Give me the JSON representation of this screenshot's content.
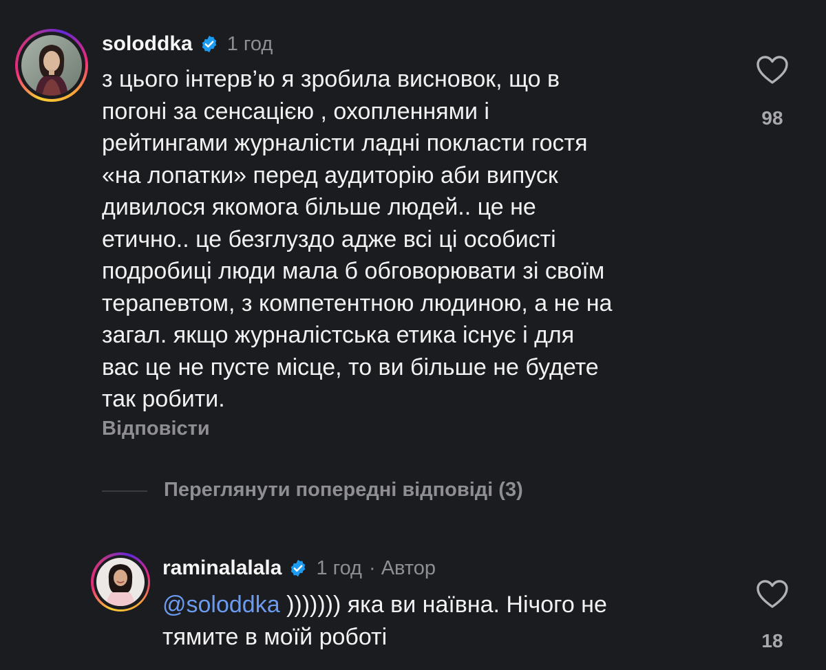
{
  "comments": [
    {
      "username": "soloddka",
      "time": "1 год",
      "body_lines": [
        "з цього інтерв’ю я зробила висновок, що в",
        "погоні за сенсацією , охопленнями і",
        "рейтингами журналісти ладні покласти гостя",
        "«на лопатки» перед аудиторію аби випуск",
        "дивилося якомога більше людей.. це не",
        "етично.. це безглуздо адже всі ці особисті",
        "подробиці люди мала б обговорювати зі своїм",
        "терапевтом, з компетентною людиною, а не на",
        "загал. якщо журналістська етика існує і для",
        "вас це не пусте місце, то ви більше не будете",
        "так робити."
      ],
      "reply_label": "Відповісти",
      "likes": "98"
    },
    {
      "username": "raminalalala",
      "time": "1 год",
      "author_badge": "· Автор",
      "mention": "@soloddka",
      "body_rest": " ))))))) яка ви наївна. Нічого не",
      "body_line2": "тямите в моїй роботі",
      "likes": "18"
    }
  ],
  "view_previous_label": "Переглянути попередні відповіді (3)",
  "colors": {
    "background": "#1b1c20",
    "text": "#f2f2f2",
    "muted": "#8e8e93",
    "mention": "#6b9bf0",
    "verified": "#1d9bf0"
  },
  "icons": {
    "verified": "verified-badge-icon",
    "like": "heart-icon"
  }
}
